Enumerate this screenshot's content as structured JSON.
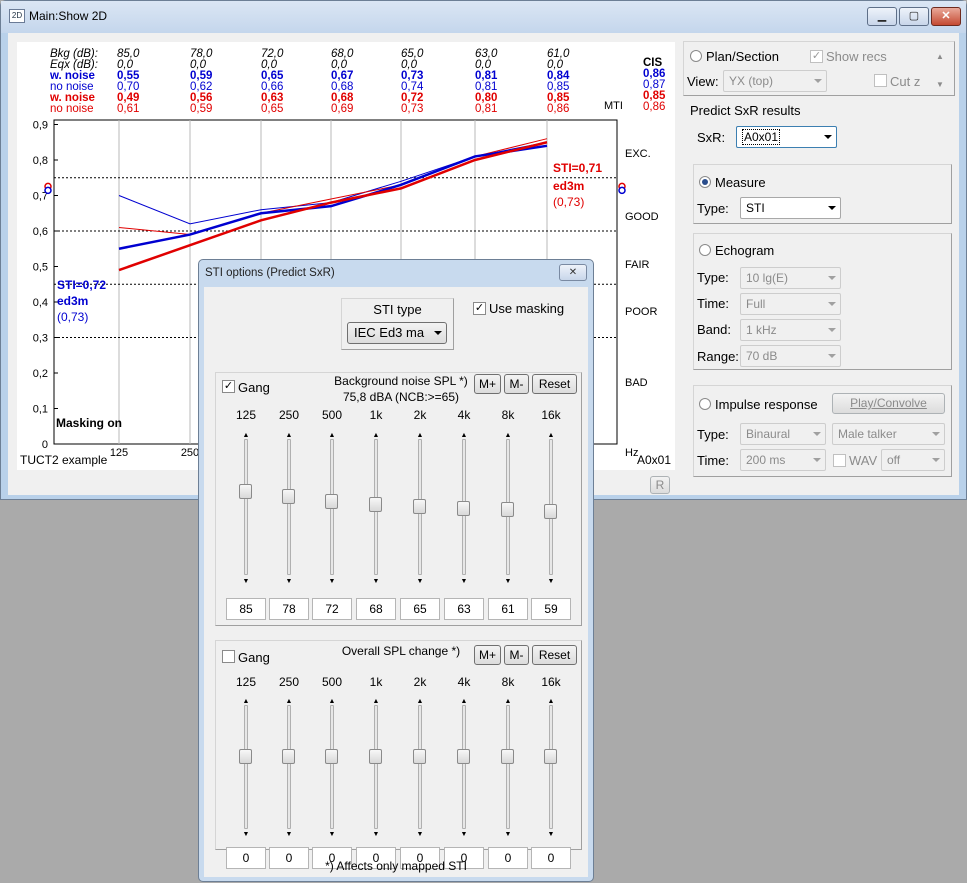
{
  "window": {
    "icon": "2D",
    "title": "Main:Show 2D"
  },
  "plot": {
    "row_labels": [
      "Bkg (dB):",
      "Eqx (dB):",
      "w. noise",
      "no noise",
      "w. noise",
      "no noise"
    ],
    "bkg": [
      "85,0",
      "78,0",
      "72,0",
      "68,0",
      "65,0",
      "63,0",
      "61,0"
    ],
    "eqx": [
      "0,0",
      "0,0",
      "0,0",
      "0,0",
      "0,0",
      "0,0",
      "0,0"
    ],
    "blue_wn": [
      "0,55",
      "0,59",
      "0,65",
      "0,67",
      "0,73",
      "0,81",
      "0,84"
    ],
    "blue_nn": [
      "0,70",
      "0,62",
      "0,66",
      "0,68",
      "0,74",
      "0,81",
      "0,85"
    ],
    "red_wn": [
      "0,49",
      "0,56",
      "0,63",
      "0,68",
      "0,72",
      "0,80",
      "0,85"
    ],
    "red_nn": [
      "0,61",
      "0,59",
      "0,65",
      "0,69",
      "0,73",
      "0,81",
      "0,86"
    ],
    "cis": {
      "label": "CIS",
      "values": [
        "0,86",
        "0,87",
        "0,85",
        "0,86"
      ]
    },
    "mti_label": "MTI",
    "y_ticks": [
      "0,9",
      "0,8",
      "0,7",
      "0,6",
      "0,5",
      "0,4",
      "0,3",
      "0,2",
      "0,1",
      "0"
    ],
    "ratings": [
      "EXC.",
      "GOOD",
      "FAIR",
      "POOR",
      "BAD"
    ],
    "x_ticks": [
      "125",
      "250"
    ],
    "x_unit": "Hz",
    "sti_left": {
      "title": "STI=0,72",
      "sub": "ed3m",
      "paren": "(0,73)"
    },
    "sti_right": {
      "title": "STI=0,71",
      "sub": "ed3m",
      "paren": "(0,73)"
    },
    "masking": "Masking on",
    "footer_left": "TUCT2 example",
    "footer_right": "A0x01",
    "r_button": "R"
  },
  "chart_data": {
    "type": "line",
    "x": [
      125,
      250,
      500,
      1000,
      2000,
      4000,
      8000
    ],
    "xlabel": "Hz",
    "ylim": [
      0,
      1
    ],
    "grid": true,
    "series": [
      {
        "name": "w. noise",
        "color": "#0000d0",
        "width": 2.5,
        "values": [
          0.55,
          0.59,
          0.65,
          0.67,
          0.73,
          0.81,
          0.84
        ]
      },
      {
        "name": "no noise",
        "color": "#0000d0",
        "width": 1,
        "values": [
          0.7,
          0.62,
          0.66,
          0.68,
          0.74,
          0.81,
          0.85
        ]
      },
      {
        "name": "w. noise",
        "color": "#e00000",
        "width": 2.5,
        "values": [
          0.49,
          0.56,
          0.63,
          0.68,
          0.72,
          0.8,
          0.85
        ]
      },
      {
        "name": "no noise",
        "color": "#e00000",
        "width": 1,
        "values": [
          0.61,
          0.59,
          0.65,
          0.69,
          0.73,
          0.81,
          0.86
        ]
      }
    ],
    "thresholds": [
      0.75,
      0.6,
      0.45,
      0.3
    ]
  },
  "right": {
    "plan_section": "Plan/Section",
    "show_recs": "Show recs",
    "view_label": "View:",
    "view_value": "YX (top)",
    "cut_z": "Cut z",
    "predict_title": "Predict SxR results",
    "sxr_label": "SxR:",
    "sxr_value": "A0x01",
    "measure": "Measure",
    "measure_type_label": "Type:",
    "measure_type_value": "STI",
    "echogram": "Echogram",
    "echo_type_label": "Type:",
    "echo_type_value": "10 lg(E)",
    "echo_time_label": "Time:",
    "echo_time_value": "Full",
    "echo_band_label": "Band:",
    "echo_band_value": "1 kHz",
    "echo_range_label": "Range:",
    "echo_range_value": "70 dB",
    "impulse": "Impulse response",
    "play_convolve": "Play/Convolve",
    "imp_type_label": "Type:",
    "imp_type_value": "Binaural",
    "talker_value": "Male talker",
    "imp_time_label": "Time:",
    "imp_time_value": "200 ms",
    "wav": "WAV",
    "wav_value": "off"
  },
  "dialog": {
    "title": "STI options (Predict SxR)",
    "close": "✕",
    "sti_type_label": "STI type",
    "sti_type_value": "IEC Ed3 ma",
    "use_masking": "Use masking",
    "bg": {
      "gang": "Gang",
      "title": "Background noise SPL *)",
      "subtitle": "75,8 dBA (NCB:>=65)",
      "mplus": "M+",
      "mminus": "M-",
      "reset": "Reset",
      "bands": [
        "125",
        "250",
        "500",
        "1k",
        "2k",
        "4k",
        "8k",
        "16k"
      ],
      "values": [
        "85",
        "78",
        "72",
        "68",
        "65",
        "63",
        "61",
        "59"
      ]
    },
    "ov": {
      "gang": "Gang",
      "title": "Overall SPL change *)",
      "mplus": "M+",
      "mminus": "M-",
      "reset": "Reset",
      "bands": [
        "125",
        "250",
        "500",
        "1k",
        "2k",
        "4k",
        "8k",
        "16k"
      ],
      "values": [
        "0",
        "0",
        "0",
        "0",
        "0",
        "0",
        "0",
        "0"
      ]
    },
    "footnote": "*) Affects only mapped STI"
  }
}
